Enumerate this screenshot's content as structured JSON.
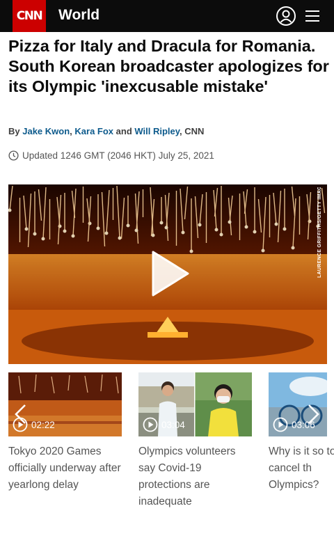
{
  "header": {
    "logo": "CNN",
    "section": "World",
    "icons": [
      "user-icon",
      "menu-icon"
    ]
  },
  "article": {
    "headline": "Pizza for Italy and Dracula for Romania. South Korean broadcaster apologizes for its Olympic 'inexcusable mistake'",
    "byline": {
      "prefix": "By ",
      "authors": [
        "Jake Kwon",
        "Kara Fox",
        "Will Ripley"
      ],
      "sep1": ", ",
      "and": " and ",
      "suffix": ", CNN"
    },
    "updated": "Updated 1246 GMT (2046 HKT) July 25, 2021",
    "video": {
      "credit": "LAURENCE GRIFFITHS/GETTY IMAGES"
    }
  },
  "related_videos": [
    {
      "duration": "02:22",
      "title": "Tokyo 2020 Games officially underway after yearlong delay"
    },
    {
      "duration": "03:04",
      "title": "Olympics volunteers say Covid-19 protections are inadequate"
    },
    {
      "duration": "03:06",
      "title": "Why is it so to cancel th Olympics?"
    }
  ],
  "colors": {
    "brand": "#cc0000",
    "topbar": "#0c0c0c",
    "author_link": "#0c5a8c"
  }
}
